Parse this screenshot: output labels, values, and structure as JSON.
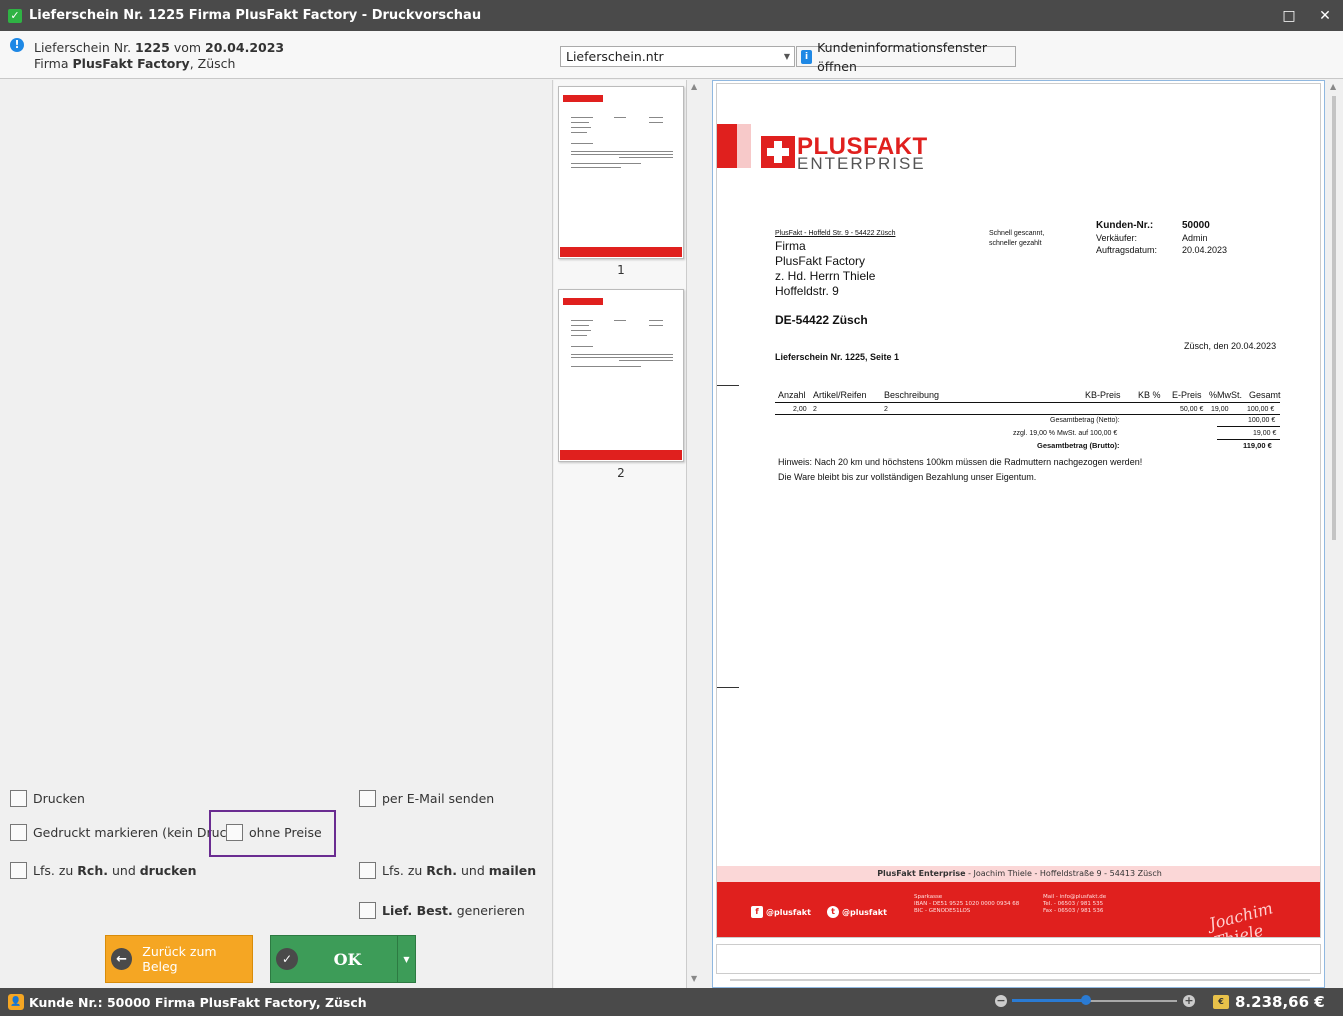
{
  "window": {
    "title": "Lieferschein Nr. 1225 Firma PlusFakt Factory - Druckvorschau",
    "minimize": "□",
    "close": "✕"
  },
  "header": {
    "prefix1": "Lieferschein Nr.",
    "number": "1225",
    "vom": "vom",
    "date": "20.04.2023",
    "prefix2": "Firma",
    "firma": "PlusFakt Factory",
    "ort": ", Züsch",
    "template": "Lieferschein.ntr",
    "kunde_button": "Kundeninformationsfenster öffnen"
  },
  "options": {
    "drucken": "Drucken",
    "gedruckt": "Gedruckt markieren (kein Druck)",
    "ohne_preise": "ohne Preise",
    "email": "per E-Mail senden",
    "lfs_rch_drucken_a": "Lfs. zu",
    "lfs_rch_drucken_b": "Rch.",
    "lfs_rch_drucken_c": "und",
    "lfs_rch_drucken_d": "drucken",
    "lfs_rch_mailen_a": "Lfs. zu",
    "lfs_rch_mailen_b": "Rch.",
    "lfs_rch_mailen_c": "und",
    "lfs_rch_mailen_d": "mailen",
    "lief_best_a": "Lief. Best.",
    "lief_best_b": "generieren"
  },
  "buttons": {
    "back": "Zurück zum Beleg",
    "ok": "OK"
  },
  "thumbnails": [
    {
      "number": "1"
    },
    {
      "number": "2"
    }
  ],
  "document": {
    "logo_line1": "PLUSFAKT",
    "logo_line2": "ENTERPRISE",
    "sender": "PlusFakt - Hoffeld Str. 9 - 54422 Züsch",
    "slogan1": "Schnell gescannt,",
    "slogan2": "schneller gezahlt",
    "kunden_label": "Kunden-Nr.:",
    "kunden_value": "50000",
    "verkaeufer_label": "Verkäufer:",
    "verkaeufer_value": "Admin",
    "auftrag_label": "Auftragsdatum:",
    "auftrag_value": "20.04.2023",
    "addr1": "Firma",
    "addr2": "PlusFakt Factory",
    "addr3": "z. Hd. Herrn Thiele",
    "addr4": "Hoffeldstr. 9",
    "addr_city": "DE-54422 Züsch",
    "place_date": "Züsch, den 20.04.2023",
    "doc_title": "Lieferschein Nr. 1225, Seite 1",
    "columns": [
      "Anzahl",
      "Artikel/Reifen",
      "Beschreibung",
      "KB-Preis",
      "KB %",
      "E-Preis",
      "%MwSt.",
      "Gesamt"
    ],
    "row": {
      "anzahl": "2,00",
      "artikel": "2",
      "beschreibung": "2",
      "epreis": "50,00 €",
      "mwst": "19,00",
      "gesamt": "100,00 €"
    },
    "netto_label": "Gesamtbetrag (Netto):",
    "netto_value": "100,00 €",
    "mwst_label": "zzgl. 19,00 % MwSt. auf 100,00 €",
    "mwst_value": "19,00 €",
    "brutto_label": "Gesamtbetrag (Brutto):",
    "brutto_value": "119,00 €",
    "hinweis1": "Hinweis: Nach 20 km und höchstens 100km müssen die Radmuttern nachgezogen werden!",
    "hinweis2": "Die Ware bleibt bis zur vollständigen Bezahlung unser Eigentum.",
    "footer_company": "PlusFakt Enterprise",
    "footer_rest": " - Joachim Thiele - Hoffeldstraße 9 - 54413 Züsch",
    "fb": "@plusfakt",
    "tw": "@plusfakt",
    "bank1": "Sparkasse",
    "bank2": "IBAN - DE51 9525 1020 0000 0934 68",
    "bank3": "BIC - GENODE51LOS",
    "contact1": "Mail - info@plusfakt.de",
    "contact2": "Tel. - 06503 / 981 535",
    "contact3": "Fax - 06503 / 981 536",
    "signature": "Joachim Thiele"
  },
  "status": {
    "kunde": "Kunde  Nr.: 50000 Firma  PlusFakt Factory, Züsch",
    "amount": "8.238,66 €",
    "zoom_fraction": 0.45
  },
  "colors": {
    "brand_red": "#e0201e",
    "ok_green": "#3d9c58",
    "back_orange": "#f5a623",
    "highlight_purple": "#6a2c91"
  }
}
